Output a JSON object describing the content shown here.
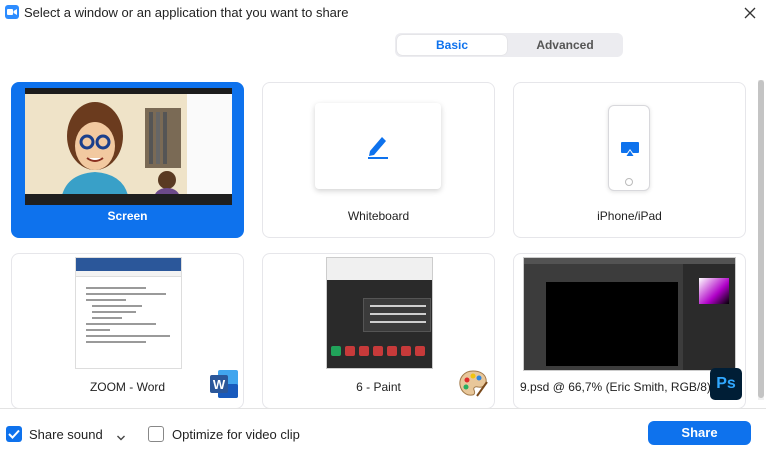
{
  "window": {
    "title": "Select a window or an application that you want to share"
  },
  "tabs": [
    {
      "label": "Basic",
      "selected": true
    },
    {
      "label": "Advanced",
      "selected": false
    }
  ],
  "tiles": [
    {
      "label": "Screen",
      "selected": true
    },
    {
      "label": "Whiteboard",
      "selected": false
    },
    {
      "label": "iPhone/iPad",
      "selected": false
    },
    {
      "label": "ZOOM - Word",
      "app_icon": "word-icon"
    },
    {
      "label": "6 - Paint",
      "app_icon": "paint-palette-icon"
    },
    {
      "label": "9.psd @ 66,7% (Eric Smith, RGB/8)",
      "app_icon": "photoshop-icon",
      "badge": "Ps"
    }
  ],
  "footer": {
    "share_sound_label": "Share sound",
    "share_sound_checked": true,
    "optimize_label": "Optimize for video clip",
    "optimize_checked": false,
    "share_button": "Share"
  },
  "colors": {
    "accent": "#0e72ed",
    "photoshop_bg": "#001e36",
    "photoshop_fg": "#31a8ff",
    "word_blue": "#2b579a"
  }
}
